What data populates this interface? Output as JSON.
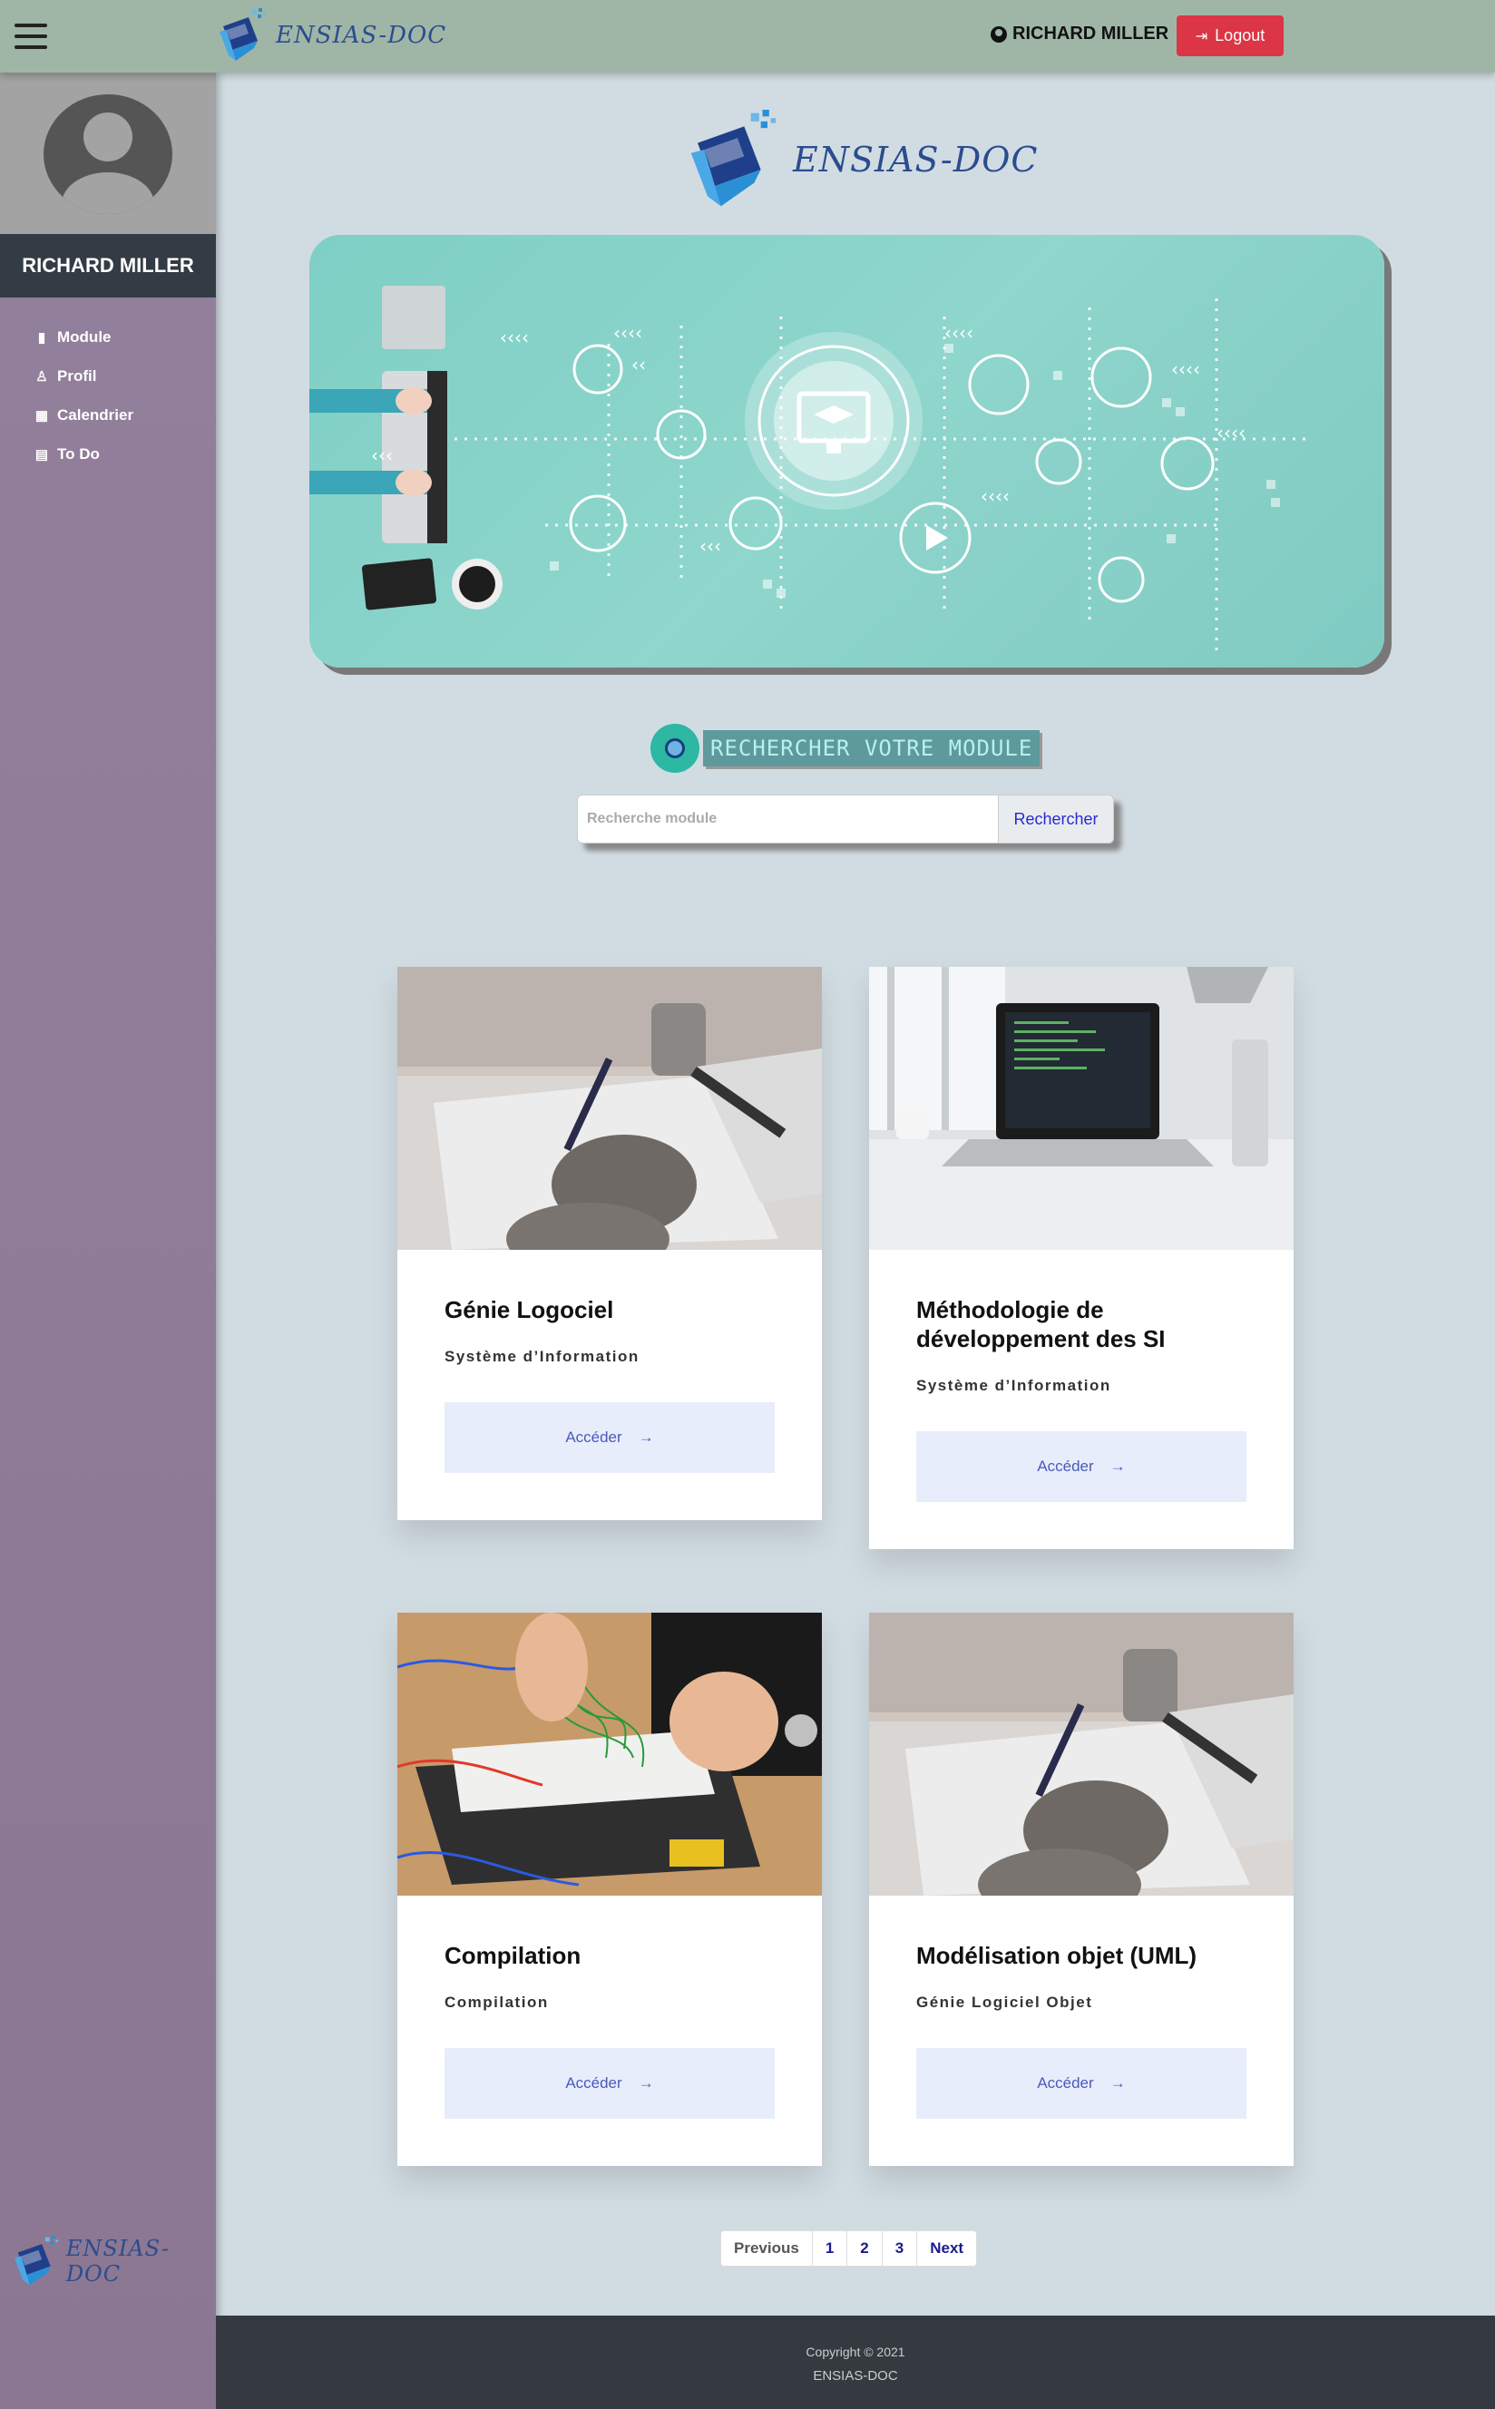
{
  "topbar": {
    "brand": "ENSIAS-DOC",
    "user_name": "RICHARD MILLER",
    "logout_label": "Logout"
  },
  "sidebar": {
    "user_name": "RICHARD MILLER",
    "items": [
      {
        "label": "Module",
        "icon": "book-icon"
      },
      {
        "label": "Profil",
        "icon": "user-tie-icon"
      },
      {
        "label": "Calendrier",
        "icon": "calendar-icon"
      },
      {
        "label": "To Do",
        "icon": "list-icon"
      }
    ],
    "brand": "ENSIAS-DOC"
  },
  "main": {
    "brand": "ENSIAS-DOC",
    "search_title": "RECHERCHER VOTRE MODULE",
    "search_placeholder": "Recherche module",
    "search_button": "Rechercher"
  },
  "cards": [
    {
      "title": "Génie Logociel",
      "subtitle": "Système d’Information",
      "button": "Accéder",
      "arrow": "→"
    },
    {
      "title": "Méthodologie de développement des SI",
      "subtitle": "Système d’Information",
      "button": "Accéder",
      "arrow": "→"
    },
    {
      "title": "Compilation",
      "subtitle": "Compilation",
      "button": "Accéder",
      "arrow": "→"
    },
    {
      "title": "Modélisation objet (UML)",
      "subtitle": "Génie Logiciel Objet",
      "button": "Accéder",
      "arrow": "→"
    }
  ],
  "pagination": {
    "previous": "Previous",
    "pages": [
      "1",
      "2",
      "3"
    ],
    "next": "Next"
  },
  "footer": {
    "copyright": "Copyright © 2021",
    "brand": "ENSIAS-DOC"
  },
  "colors": {
    "topbar": "#9fb6a6",
    "sidebar": "#8b7792",
    "logout": "#dc3545",
    "footer": "#343a40",
    "hero": "#7ecfc5"
  }
}
